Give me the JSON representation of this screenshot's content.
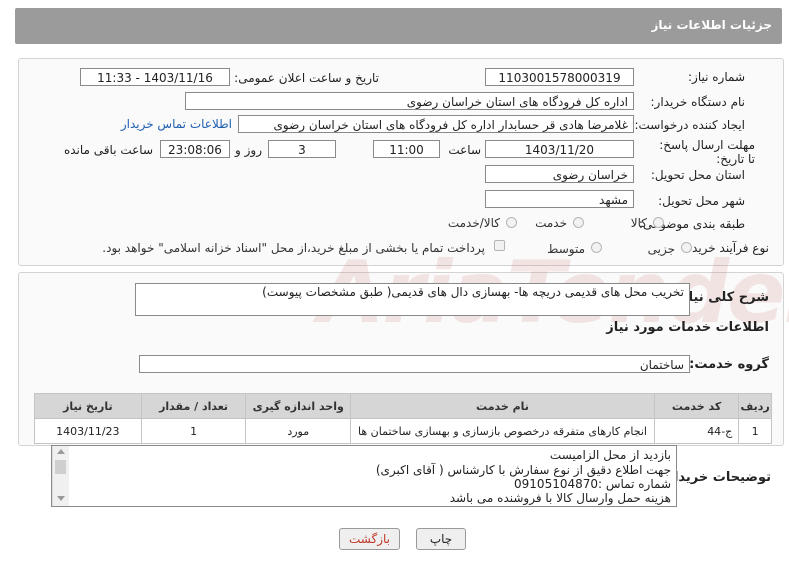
{
  "header": {
    "title": "جزئیات اطلاعات نیاز"
  },
  "form": {
    "need_number_label": "شماره نیاز:",
    "need_number": "1103001578000319",
    "announce_label": "تاریخ و ساعت اعلان عمومی:",
    "announce_value": "1403/11/16 - 11:33",
    "buyer_label": "نام دستگاه خریدار:",
    "buyer_value": "اداره کل فرودگاه های استان خراسان رضوی",
    "creator_label": "ایجاد کننده درخواست:",
    "creator_value": "غلامرضا هادی قر حسابدار اداره کل فرودگاه های استان خراسان رضوی",
    "contact_link": "اطلاعات تماس خریدار",
    "deadline_label": "مهلت ارسال پاسخ: تا تاریخ:",
    "deadline_date": "1403/11/20",
    "time_label": "ساعت",
    "deadline_time": "11:00",
    "days_value": "3",
    "days_label": "روز و",
    "remaining_time": "23:08:06",
    "remaining_label": "ساعت باقی مانده",
    "province_label": "استان محل تحویل:",
    "province_value": "خراسان رضوی",
    "city_label": "شهر محل تحویل:",
    "city_value": "مشهد",
    "category_label": "طبقه بندی موضوعی:",
    "category_options": [
      "کالا",
      "خدمت",
      "کالا/خدمت"
    ],
    "process_label": "نوع فرآیند خرید :",
    "process_options": [
      "جزیی",
      "متوسط"
    ],
    "payment_note": "پرداخت تمام یا بخشی از مبلغ خرید،از محل \"اسناد خزانه اسلامی\" خواهد بود."
  },
  "summary": {
    "label": "شرح کلی نیاز:",
    "value": "تخریب محل های قدیمی دریچه ها- بهسازی دال های قدیمی( طبق مشخصات پیوست)"
  },
  "services": {
    "section_title": "اطلاعات خدمات مورد نیاز",
    "group_label": "گروه خدمت:",
    "group_value": "ساختمان",
    "columns": [
      "ردیف",
      "کد خدمت",
      "نام خدمت",
      "واحد اندازه گیری",
      "تعداد / مقدار",
      "تاریخ نیاز"
    ],
    "rows": [
      [
        "1",
        "ج-44",
        "انجام کارهای متفرقه درخصوص بازسازی و بهسازی ساختمان ها",
        "مورد",
        "1",
        "1403/11/23"
      ]
    ]
  },
  "notes": {
    "label": "توضیحات خریدار:",
    "lines": [
      "بازدید از محل الزامیست",
      "جهت اطلاع دقیق از نوع سفارش با کارشناس   ( آقای اکبری)",
      "شماره تماس :09105104870",
      "هزینه حمل وارسال کالا با فروشنده می باشد"
    ]
  },
  "buttons": {
    "print": "چاپ",
    "back": "بازگشت"
  },
  "watermark": {
    "text": "AriaTender.neT"
  },
  "colors": {
    "header_bg": "#9b9b9b",
    "link": "#1f5fb0",
    "back_text": "#c0392b"
  }
}
